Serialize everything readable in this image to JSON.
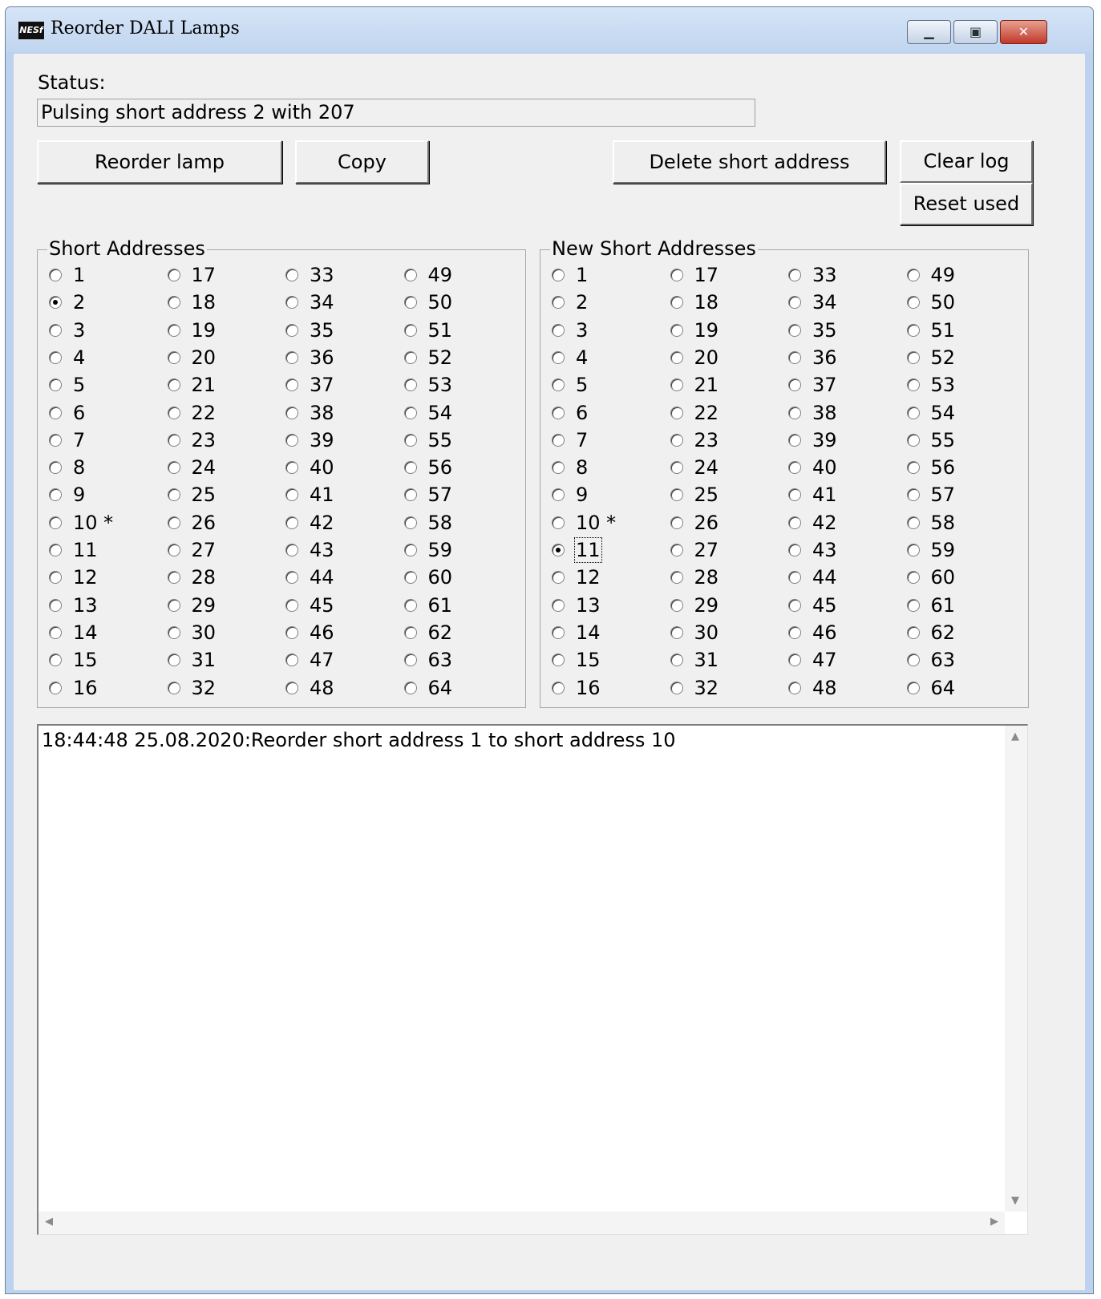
{
  "window": {
    "title": "Reorder DALI Lamps",
    "icon_text": "NESf"
  },
  "status": {
    "label": "Status:",
    "value": "Pulsing short address 2 with 207"
  },
  "buttons": {
    "reorder": "Reorder lamp",
    "copy": "Copy",
    "delete": "Delete short address",
    "clear_log": "Clear log",
    "reset_used": "Reset used"
  },
  "short_addresses": {
    "title": "Short Addresses",
    "selected": "2",
    "labels": [
      "1",
      "2",
      "3",
      "4",
      "5",
      "6",
      "7",
      "8",
      "9",
      "10 *",
      "11",
      "12",
      "13",
      "14",
      "15",
      "16",
      "17",
      "18",
      "19",
      "20",
      "21",
      "22",
      "23",
      "24",
      "25",
      "26",
      "27",
      "28",
      "29",
      "30",
      "31",
      "32",
      "33",
      "34",
      "35",
      "36",
      "37",
      "38",
      "39",
      "40",
      "41",
      "42",
      "43",
      "44",
      "45",
      "46",
      "47",
      "48",
      "49",
      "50",
      "51",
      "52",
      "53",
      "54",
      "55",
      "56",
      "57",
      "58",
      "59",
      "60",
      "61",
      "62",
      "63",
      "64"
    ]
  },
  "new_short_addresses": {
    "title": "New Short Addresses",
    "selected": "11",
    "labels": [
      "1",
      "2",
      "3",
      "4",
      "5",
      "6",
      "7",
      "8",
      "9",
      "10 *",
      "11",
      "12",
      "13",
      "14",
      "15",
      "16",
      "17",
      "18",
      "19",
      "20",
      "21",
      "22",
      "23",
      "24",
      "25",
      "26",
      "27",
      "28",
      "29",
      "30",
      "31",
      "32",
      "33",
      "34",
      "35",
      "36",
      "37",
      "38",
      "39",
      "40",
      "41",
      "42",
      "43",
      "44",
      "45",
      "46",
      "47",
      "48",
      "49",
      "50",
      "51",
      "52",
      "53",
      "54",
      "55",
      "56",
      "57",
      "58",
      "59",
      "60",
      "61",
      "62",
      "63",
      "64"
    ]
  },
  "log": {
    "lines": [
      "18:44:48 25.08.2020:Reorder short address 1 to short address 10"
    ]
  },
  "colors": {
    "frame": "#bcd2ee",
    "client": "#f0f0f0",
    "close_button": "#c0392b"
  }
}
